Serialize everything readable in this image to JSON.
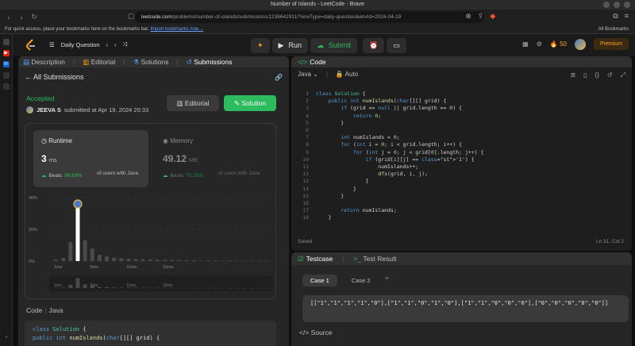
{
  "window": {
    "title": "Number of Islands - LeetCode - Brave"
  },
  "browser": {
    "url_host": "leetcode.com",
    "url_path": "/problems/number-of-islands/submissions/1236642911/?envType=daily-question&envId=2024-04-19"
  },
  "bookmarks": {
    "prompt": "For quick access, place your bookmarks here on the bookmarks bar.",
    "import_link": "Import bookmarks now…",
    "all_label": "All Bookmarks"
  },
  "header": {
    "daily_label": "Daily Question",
    "run_label": "Run",
    "submit_label": "Submit",
    "streak": "50",
    "premium_label": "Premium"
  },
  "left": {
    "tabs": [
      "Description",
      "Editorial",
      "Solutions",
      "Submissions"
    ],
    "back_label": "All Submissions",
    "status": "Accepted",
    "user": "JEEVA S",
    "submitted_text": "submitted at Apr 19, 2024 20:33",
    "editorial_btn": "Editorial",
    "solution_btn": "Solution",
    "runtime": {
      "title": "Runtime",
      "value": "3",
      "unit": "ms",
      "beats_label": "Beats",
      "beats_pct": "86.63%",
      "note": "of users with Java"
    },
    "memory": {
      "title": "Memory",
      "value": "49.12",
      "unit": "MB",
      "beats_label": "Beats",
      "beats_pct": "75.35%",
      "note": "of users with Java"
    },
    "code_label": "Code",
    "lang_label": "Java",
    "code_preview": [
      "class Solution {",
      "    public int numIslands(char[][] grid) {"
    ]
  },
  "chart_data": {
    "type": "bar",
    "title": "",
    "ylabel": "",
    "y_ticks": [
      "40%",
      "20%",
      "0%"
    ],
    "ylim": [
      0,
      40
    ],
    "x_ticks": [
      "1ms",
      "6ms",
      "11ms",
      "16ms"
    ],
    "mini_ticks": [
      "1ms",
      "6ms",
      "11ms",
      "16ms"
    ],
    "highlight_index": 3,
    "values": [
      1,
      2,
      12,
      36,
      13,
      8,
      4,
      3,
      2.2,
      1.8,
      1.5,
      1.3,
      1.2,
      1,
      0.9,
      0.8,
      0.7,
      0.6,
      0.5,
      0.5,
      0.4,
      0.4,
      0.3,
      0.3,
      0.3,
      0.2,
      0.2,
      0.2,
      0.2,
      0.2
    ]
  },
  "code": {
    "title": "Code",
    "language": "Java",
    "mode": "Auto",
    "lines": [
      "class Solution {",
      "    public int numIslands(char[][] grid) {",
      "        if (grid == null || grid.length == 0) {",
      "            return 0;",
      "        }",
      "",
      "        int numIslands = 0;",
      "        for (int i = 0; i < grid.length; i++) {",
      "            for (int j = 0; j < grid[0].length; j++) {",
      "                if (grid[i][j] == '1') {",
      "                    numIslands++;",
      "                    dfs(grid, i, j);",
      "                }",
      "            }",
      "        }",
      "",
      "        return numIslands;",
      "    }"
    ],
    "saved": "Saved",
    "cursor": "Ln 31, Col 2"
  },
  "testcase": {
    "tab_testcase": "Testcase",
    "tab_result": "Test Result",
    "cases": [
      "Case 1",
      "Case 2"
    ],
    "input": "[[\"1\",\"1\",\"1\",\"1\",\"0\"],[\"1\",\"1\",\"0\",\"1\",\"0\"],[\"1\",\"1\",\"0\",\"0\",\"0\"],[\"0\",\"0\",\"0\",\"0\",\"0\"]]",
    "source_label": "Source"
  },
  "colors": {
    "accent_green": "#2cbb5d",
    "accent_orange": "#ffa116",
    "bg": "#0f0f0f"
  }
}
